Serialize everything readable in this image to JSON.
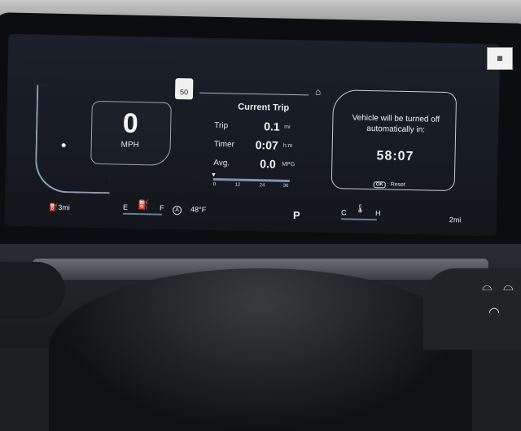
{
  "cluster": {
    "speed": {
      "value": "0",
      "unit": "MPH"
    },
    "speed_sign": "50",
    "trip": {
      "title": "Current Trip",
      "rows": [
        {
          "label": "Trip",
          "value": "0.1",
          "unit": "mi"
        },
        {
          "label": "Timer",
          "value": "0:07",
          "unit": "h:m"
        },
        {
          "label": "Avg.",
          "value": "0.0",
          "unit": "MPG"
        }
      ],
      "scale_ticks": [
        "0",
        "12",
        "24",
        "36"
      ]
    },
    "notice": {
      "message": "Vehicle will be turned off automatically in:",
      "countdown": "58:07",
      "ok_label": "OK",
      "reset_label": ": Reset"
    },
    "status_bar": {
      "range": "3mi",
      "fuel_empty": "E",
      "fuel_full": "F",
      "outside_temp": "48°F",
      "gear": "P",
      "temp_cold": "C",
      "temp_hot": "H",
      "odo": "2mi"
    }
  }
}
